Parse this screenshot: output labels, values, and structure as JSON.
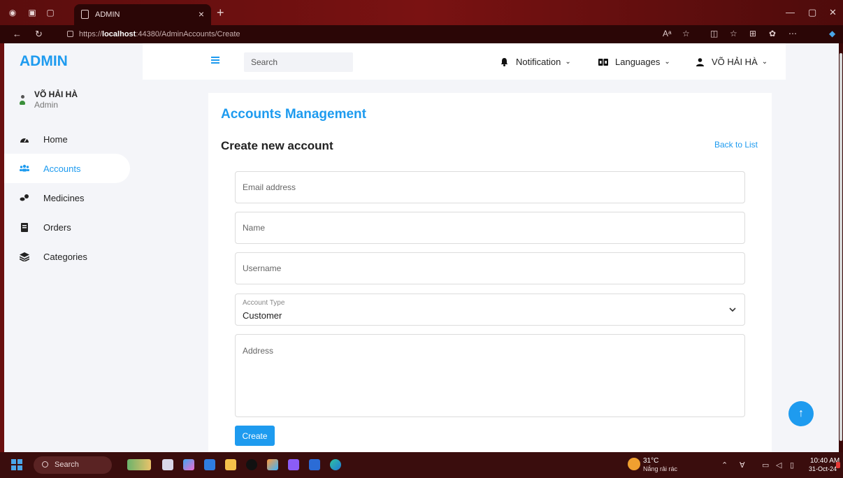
{
  "browser": {
    "tab_title": "ADMIN",
    "tab_close": "×",
    "new_tab": "+",
    "url_prefix": "https://",
    "url_host": "localhost",
    "url_path": ":44380/AdminAccounts/Create",
    "read_aloud": "Aᵃ"
  },
  "sidebar": {
    "logo": "ADMIN",
    "user_name": "VÕ HẢI HÀ",
    "user_role": "Admin",
    "items": [
      {
        "label": "Home",
        "icon": "dashboard-icon"
      },
      {
        "label": "Accounts",
        "icon": "users-icon",
        "active": true
      },
      {
        "label": "Medicines",
        "icon": "pills-icon"
      },
      {
        "label": "Orders",
        "icon": "receipt-icon"
      },
      {
        "label": "Categories",
        "icon": "layers-icon"
      }
    ]
  },
  "topbar": {
    "search_placeholder": "Search",
    "notification": "Notification",
    "languages": "Languages",
    "user": "VÕ HẢI HÀ"
  },
  "form": {
    "heading": "Accounts Management",
    "subheading": "Create new account",
    "back_link": "Back to List",
    "email_placeholder": "Email address",
    "name_placeholder": "Name",
    "username_placeholder": "Username",
    "account_type_label": "Account Type",
    "account_type_value": "Customer",
    "address_placeholder": "Address",
    "create_button": "Create"
  },
  "taskbar": {
    "search": "Search",
    "weather_temp": "31°C",
    "weather_desc": "Nắng rải rác",
    "time": "10:40 AM",
    "date": "31-Oct-24"
  },
  "colors": {
    "accent": "#1e9bef",
    "browser_frame": "#6a1010"
  }
}
